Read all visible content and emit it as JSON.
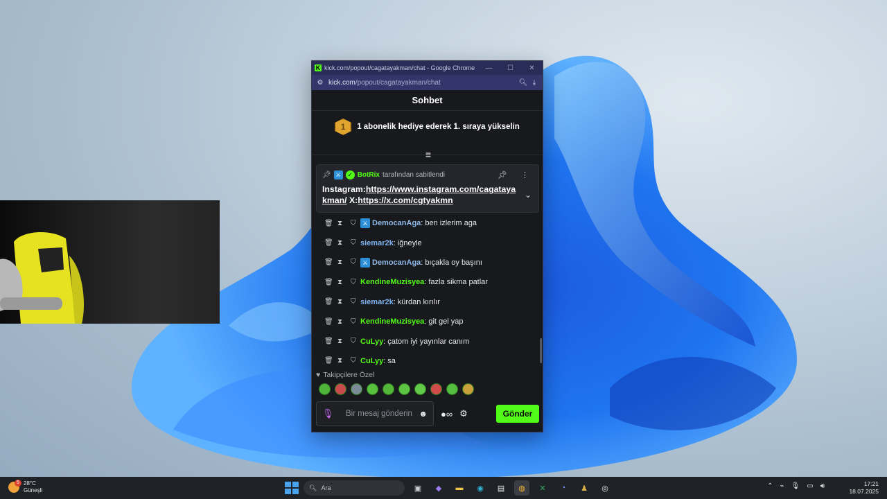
{
  "window": {
    "title": "kick.com/popout/cagatayakman/chat - Google Chrome",
    "url_host": "kick.com",
    "url_path": "/popout/cagatayakman/chat",
    "controls": {
      "minimize": "—",
      "maximize": "☐",
      "close": "✕"
    }
  },
  "chat": {
    "header": "Sohbet",
    "gift_rank": "1",
    "gift_text": "1 abonelik hediye ederek 1. sıraya yükselin",
    "pinned": {
      "user": "BotRix",
      "suffix": "tarafından sabitlendi",
      "line1_label": "Instagram:",
      "line1_link": "https://www.instagram.com/cagatayakman/",
      "line2_label": " X:",
      "line2_link": "https://x.com/cgtyakmn"
    },
    "messages": [
      {
        "user": "DemocanAga",
        "text": "ben izlerim aga",
        "color": "demo",
        "mod": true
      },
      {
        "user": "siemar2k",
        "text": "iğneyle",
        "color": "blue",
        "mod": false
      },
      {
        "user": "DemocanAga",
        "text": "bıçakla oy başını",
        "color": "demo",
        "mod": true
      },
      {
        "user": "KendineMuzisyea",
        "text": "fazla sikma patlar",
        "color": "green",
        "mod": false
      },
      {
        "user": "siemar2k",
        "text": "kürdan kırılır",
        "color": "blue",
        "mod": false
      },
      {
        "user": "KendineMuzisyea",
        "text": "git gel yap",
        "color": "green",
        "mod": false
      },
      {
        "user": "CuLyy",
        "text": "çatom iyi yayınlar canım",
        "color": "green",
        "mod": false
      },
      {
        "user": "CuLyy",
        "text": "sa",
        "color": "green",
        "mod": false
      }
    ],
    "emote_section_label": "Takipçilere Özel",
    "emote_count": 10,
    "input_placeholder": "Bir mesaj gönderin",
    "send_label": "Gönder"
  },
  "taskbar": {
    "temperature": "28°C",
    "weather": "Güneşli",
    "weather_badge": "5",
    "search_placeholder": "Ara",
    "time": "17:21",
    "date": "18.07.2025"
  },
  "colors": {
    "kick_green": "#53fc18",
    "titlebar": "#2a2c58",
    "chat_bg": "#18191c"
  }
}
